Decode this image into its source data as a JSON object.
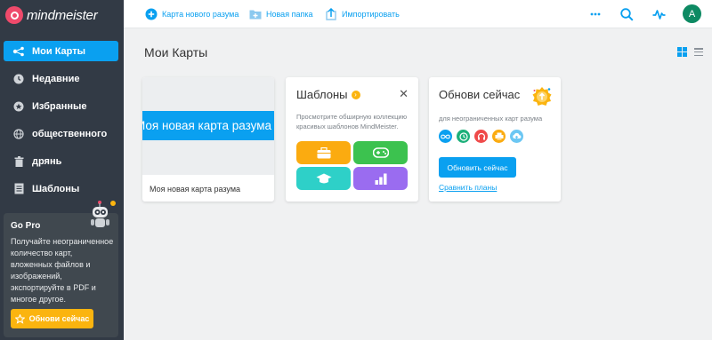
{
  "app": {
    "logo_text": "mindmeister"
  },
  "sidebar": {
    "items": [
      {
        "label": "Мои Карты",
        "icon": "mindmap-icon",
        "active": true
      },
      {
        "label": "Недавние",
        "icon": "clock-icon",
        "active": false
      },
      {
        "label": "Избранные",
        "icon": "star-icon",
        "active": false
      },
      {
        "label": "общественного",
        "icon": "globe-icon",
        "active": false
      },
      {
        "label": "дрянь",
        "icon": "trash-icon",
        "active": false
      },
      {
        "label": "Шаблоны",
        "icon": "template-icon",
        "active": false
      }
    ],
    "gopro": {
      "title": "Go Pro",
      "text": "Получайте неограниченное количество карт, вложенных файлов и изображений, экспортируйте в PDF и многое другое.",
      "button": "Обнови сейчас"
    }
  },
  "topbar": {
    "new_map": "Карта нового разума",
    "new_folder": "Новая папка",
    "import": "Импортировать",
    "avatar_letter": "A"
  },
  "main": {
    "title": "Мои Карты",
    "map_card": {
      "thumb_text": "Моя новая карта разума",
      "name": "Моя новая карта разума"
    },
    "templates_card": {
      "title": "Шаблоны",
      "description": "Просмотрите обширную коллекцию красивых шаблонов MindMeister.",
      "tiles": [
        {
          "icon": "briefcase-icon",
          "color": "#fbab10"
        },
        {
          "icon": "gamepad-icon",
          "color": "#3cc24f"
        },
        {
          "icon": "graduation-cap-icon",
          "color": "#2ed0c8"
        },
        {
          "icon": "bar-chart-icon",
          "color": "#9a6cf0"
        }
      ]
    },
    "upgrade_card": {
      "title": "Обнови сейчас",
      "subtitle": "для неограниченных карт разума",
      "button": "Обновить сейчас",
      "compare_link": "Сравнить планы"
    }
  },
  "colors": {
    "accent": "#0aa0f0",
    "sidebar": "#323a45",
    "cta": "#fbb40f"
  }
}
